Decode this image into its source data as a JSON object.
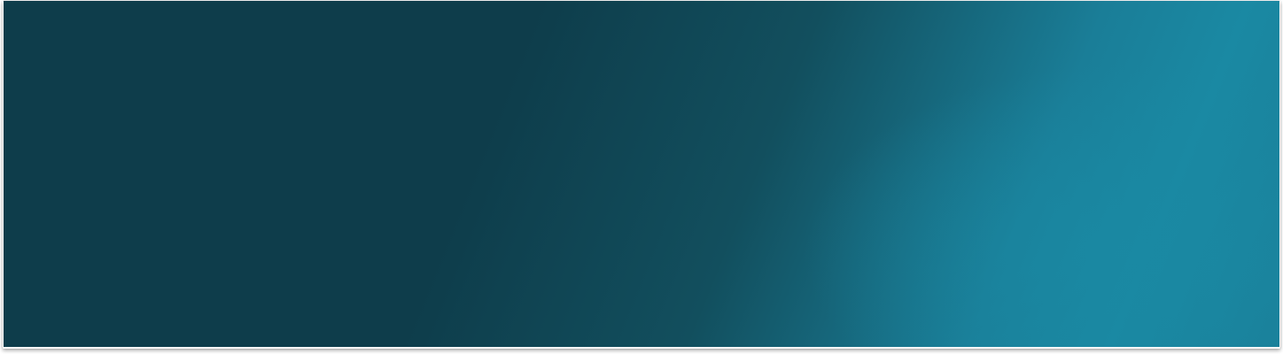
{
  "banner": {
    "colors": {
      "base_dark": "#0e3d4b",
      "mid": "#124f5e",
      "accent_light": "#1a89a3",
      "accent_edge": "#1a7e98"
    }
  }
}
